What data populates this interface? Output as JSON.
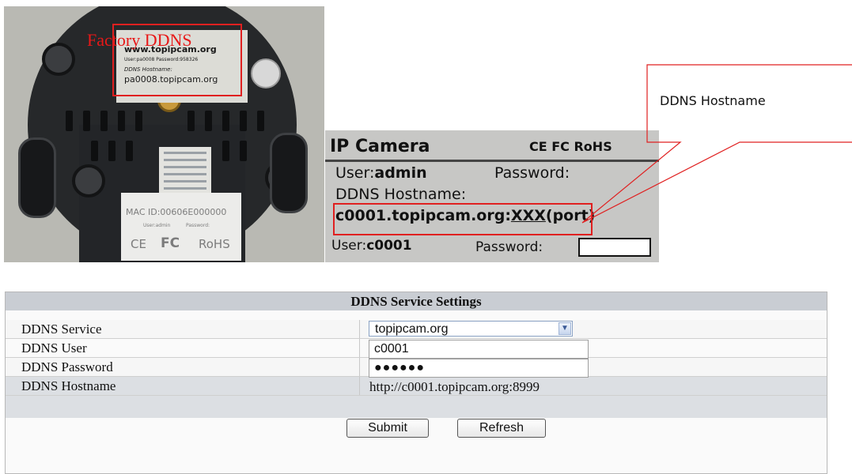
{
  "annotations": {
    "factory_label": "Factory DDNS",
    "callout_text": "DDNS Hostname",
    "accent_color": "#e02020"
  },
  "camera_back": {
    "sticker_lines": [
      "www.topipcam.org",
      "User:pa0008   Password:958326",
      "DDNS Hostname:",
      "pa0008.topipcam.org"
    ],
    "mac_label": "MAC ID:00606E000000",
    "mini_labels": [
      "User:admin",
      "Password:"
    ],
    "cert_marks": [
      "CE",
      "FC",
      "RoHS"
    ]
  },
  "camera_label": {
    "brand": "IP Camera",
    "cert_marks": "CE FC RoHS",
    "user_line_prefix": "User:",
    "user_value": "admin",
    "password_label": "Password:",
    "ddns_hostname_label": "DDNS Hostname:",
    "hostname_value": "c0001.topipcam.org:",
    "port_placeholder": "XXX",
    "port_suffix": "(port)",
    "ddns_user_prefix": "User:",
    "ddns_user_value": "c0001",
    "ddns_password_label": "Password:"
  },
  "ddns_settings": {
    "title": "DDNS Service Settings",
    "service_label": "DDNS Service",
    "service_value": "topipcam.org",
    "user_label": "DDNS User",
    "user_value": "c0001",
    "password_label": "DDNS Password",
    "password_value": "●●●●●●",
    "hostname_label": "DDNS Hostname",
    "hostname_value": "http://c0001.topipcam.org:8999",
    "submit_label": "Submit",
    "refresh_label": "Refresh"
  }
}
